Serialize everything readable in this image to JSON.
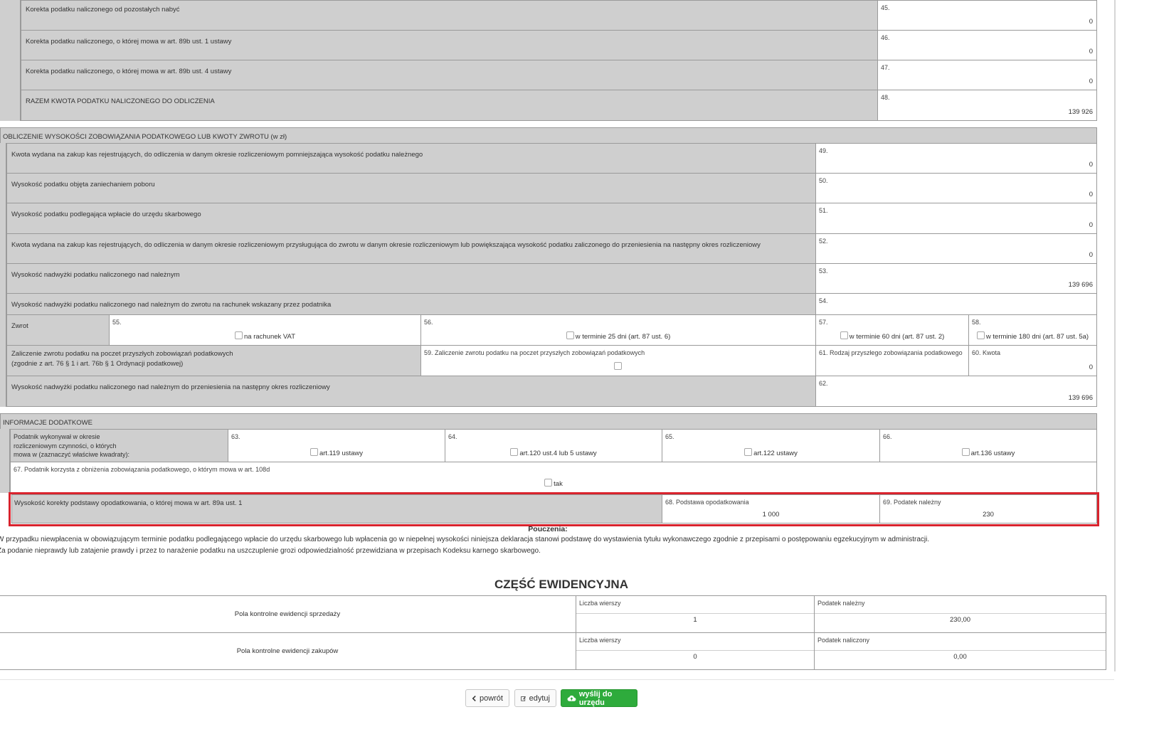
{
  "top_rows": [
    {
      "label": "Korekta podatku naliczonego od pozostałych nabyć",
      "num": "45.",
      "value": "0"
    },
    {
      "label": "Korekta podatku naliczonego, o której mowa w art. 89b ust. 1 ustawy",
      "num": "46.",
      "value": "0"
    },
    {
      "label": "Korekta podatku naliczonego, o której mowa w art. 89b ust. 4 ustawy",
      "num": "47.",
      "value": "0"
    },
    {
      "label": "RAZEM KWOTA PODATKU NALICZONEGO DO ODLICZENIA",
      "num": "48.",
      "value": "139 926"
    }
  ],
  "section_calc": {
    "header": "OBLICZENIE WYSOKOŚCI ZOBOWIĄZANIA PODATKOWEGO LUB KWOTY ZWROTU (w zł)",
    "rows": [
      {
        "label": "Kwota wydana na zakup kas rejestrujących, do odliczenia w danym okresie rozliczeniowym pomniejszająca wysokość podatku należnego",
        "num": "49.",
        "value": "0"
      },
      {
        "label": "Wysokość podatku objęta zaniechaniem poboru",
        "num": "50.",
        "value": "0"
      },
      {
        "label": "Wysokość podatku podlegająca wpłacie do urzędu skarbowego",
        "num": "51.",
        "value": "0"
      },
      {
        "label": "Kwota wydana na zakup kas rejestrujących, do odliczenia w danym okresie rozliczeniowym przysługująca do zwrotu w danym okresie rozliczeniowym lub powiększająca wysokość podatku zaliczonego do przeniesienia na następny okres rozliczeniowy",
        "num": "52.",
        "value": "0"
      },
      {
        "label": "Wysokość nadwyżki podatku naliczonego nad należnym",
        "num": "53.",
        "value": "139 696"
      },
      {
        "label": "Wysokość nadwyżki podatku naliczonego nad należnym do zwrotu na rachunek wskazany przez podatnika",
        "num": "54.",
        "value": ""
      }
    ],
    "zwrot": {
      "label": "Zwrot",
      "options": [
        {
          "num": "55.",
          "text": "na rachunek VAT"
        },
        {
          "num": "56.",
          "text": "w terminie 25 dni (art. 87 ust. 6)"
        },
        {
          "num": "57.",
          "text": "w terminie 60 dni (art. 87 ust. 2)"
        },
        {
          "num": "58.",
          "text": "w terminie 180 dni (art. 87 ust. 5a)"
        }
      ]
    },
    "zaliczenie": {
      "label_line1": "Zaliczenie zwrotu podatku na poczet przyszłych zobowiązań podatkowych",
      "label_line2": "(zgodnie z art. 76 § 1 i art. 76b § 1 Ordynacji podatkowej)",
      "f59": "59. Zaliczenie zwrotu podatku na poczet przyszłych zobowiązań podatkowych",
      "f61": "61. Rodzaj przyszłego zobowiązania podatkowego",
      "f60": "60. Kwota",
      "f60_value": "0"
    },
    "przeniesienie": {
      "label": "Wysokość nadwyżki podatku naliczonego nad należnym do przeniesienia na następny okres rozliczeniowy",
      "num": "62.",
      "value": "139 696"
    }
  },
  "section_info": {
    "header": "INFORMACJE DODATKOWE",
    "podatnik_line1": "Podatnik wykonywał w okresie",
    "podatnik_line2": "rozliczeniowym czynności, o których",
    "podatnik_line3": "mowa w (zaznaczyć właściwe kwadraty):",
    "options": [
      {
        "num": "63.",
        "text": "art.119 ustawy"
      },
      {
        "num": "64.",
        "text": "art.120 ust.4 lub 5 ustawy"
      },
      {
        "num": "65.",
        "text": "art.122 ustawy"
      },
      {
        "num": "66.",
        "text": "art.136 ustawy"
      }
    ],
    "f67": "67. Podatnik korzysta z obniżenia zobowiązania podatkowego, o którym mowa w art. 108d",
    "f67_option": "tak",
    "korekta_label": "Wysokość korekty podstawy opodatkowania, o której mowa w art. 89a ust. 1",
    "f68": "68. Podstawa opodatkowania",
    "f68_value": "1 000",
    "f69": "69. Podatek należny",
    "f69_value": "230"
  },
  "pouczenia": {
    "title": "Pouczenia:",
    "line1": "W przypadku niewpłacenia w obowiązującym terminie podatku podlegającego wpłacie do urzędu skarbowego lub wpłacenia go w niepełnej wysokości niniejsza deklaracja stanowi podstawę do wystawienia tytułu wykonawczego zgodnie z przepisami o postępowaniu egzekucyjnym w administracji.",
    "line2": "Za podanie nieprawdy lub zatajenie prawdy i przez to narażenie podatku na uszczuplenie grozi odpowiedzialność przewidziana w przepisach Kodeksu karnego skarbowego."
  },
  "ewidencja": {
    "title": "CZĘŚĆ EWIDENCYJNA",
    "sprzedaz": {
      "label": "Pola kontrolne ewidencji sprzedaży",
      "h1": "Liczba wierszy",
      "v1": "1",
      "h2": "Podatek należny",
      "v2": "230,00"
    },
    "zakupy": {
      "label": "Pola kontrolne ewidencji zakupów",
      "h1": "Liczba wierszy",
      "v1": "0",
      "h2": "Podatek naliczony",
      "v2": "0,00"
    }
  },
  "buttons": {
    "back": "powrót",
    "edit": "edytuj",
    "send": "wyślij do urzędu"
  },
  "colors": {
    "highlight": "#d9232d",
    "send_button": "#2eab3c",
    "gray_cell": "#cfcfcf"
  }
}
